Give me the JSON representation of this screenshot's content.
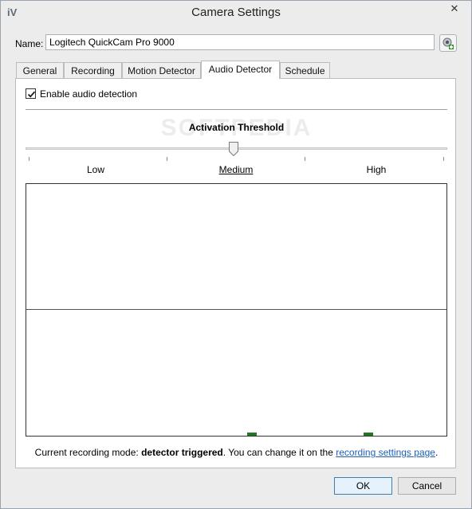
{
  "window": {
    "app_icon": "iV",
    "title": "Camera Settings",
    "close_glyph": "✕"
  },
  "name_field": {
    "label": "Name:",
    "value": "Logitech QuickCam Pro 9000"
  },
  "tabs": [
    {
      "label": "General",
      "active": false
    },
    {
      "label": "Recording",
      "active": false
    },
    {
      "label": "Motion Detector",
      "active": false
    },
    {
      "label": "Audio Detector",
      "active": true
    },
    {
      "label": "Schedule",
      "active": false
    }
  ],
  "audio": {
    "enable_label": "Enable audio detection",
    "enabled": true,
    "threshold_title": "Activation Threshold",
    "threshold_level": 0.5,
    "levels": {
      "low": "Low",
      "medium": "Medium",
      "high": "High"
    }
  },
  "watermark": "SOFTPEDIA",
  "status": {
    "prefix": "Current recording mode: ",
    "mode": "detector triggered",
    "middle": ". You can change it on the ",
    "link": "recording settings page",
    "suffix": "."
  },
  "buttons": {
    "ok": "OK",
    "cancel": "Cancel"
  },
  "colors": {
    "bar": "#1f7a1f",
    "link": "#1d5fb8",
    "ok_border": "#3c7fb1"
  }
}
